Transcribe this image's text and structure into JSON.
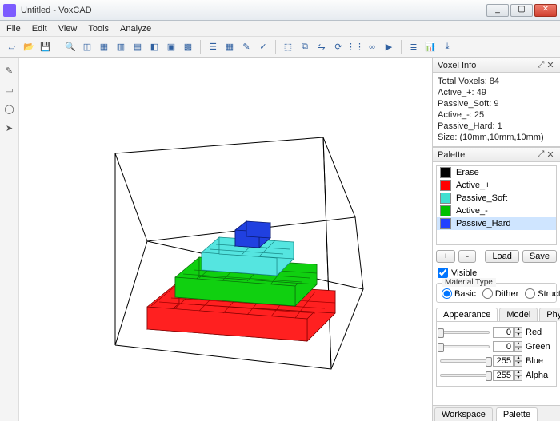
{
  "window": {
    "title": "Untitled - VoxCAD"
  },
  "menu": [
    "File",
    "Edit",
    "View",
    "Tools",
    "Analyze"
  ],
  "toolbar_icons": [
    "new-icon",
    "open-icon",
    "save-icon",
    "",
    "zoom-extents-icon",
    "view-persp-icon",
    "view-top-icon",
    "view-front-icon",
    "view-side-icon",
    "view-iso-icon",
    "wireframe-icon",
    "shaded-icon",
    "",
    "list-icon",
    "grid-icon",
    "paint-icon",
    "check-icon",
    "",
    "select-icon",
    "copy-icon",
    "mirror-icon",
    "rotate-icon",
    "array-icon",
    "link-icon",
    "sim-icon",
    "",
    "layers-icon",
    "stats-icon",
    "export-icon"
  ],
  "left_tools": [
    "pencil-icon",
    "box-icon",
    "ellipse-icon",
    "pointer-icon"
  ],
  "voxel_info": {
    "title": "Voxel Info",
    "lines": [
      "Total Voxels: 84",
      "Active_+: 49",
      "Passive_Soft: 9",
      "Active_-: 25",
      "Passive_Hard: 1",
      "Size: (10mm,10mm,10mm)"
    ]
  },
  "palette": {
    "title": "Palette",
    "materials": [
      {
        "name": "Erase",
        "color": "#000000"
      },
      {
        "name": "Active_+",
        "color": "#ff0000"
      },
      {
        "name": "Passive_Soft",
        "color": "#40e0d0"
      },
      {
        "name": "Active_-",
        "color": "#00c000"
      },
      {
        "name": "Passive_Hard",
        "color": "#2040ff"
      }
    ],
    "selected_index": 4,
    "buttons": {
      "add": "+",
      "remove": "-",
      "load": "Load",
      "save": "Save"
    },
    "visible_label": "Visible",
    "visible_checked": true,
    "material_type": {
      "label": "Material Type",
      "options": [
        "Basic",
        "Dither",
        "Structure"
      ],
      "selected": 0
    },
    "prop_tabs": [
      "Appearance",
      "Model",
      "Physical"
    ],
    "prop_tab_selected": 0,
    "channels": [
      {
        "label": "Red",
        "value": 0,
        "pos": 0
      },
      {
        "label": "Green",
        "value": 0,
        "pos": 0
      },
      {
        "label": "Blue",
        "value": 255,
        "pos": 100
      },
      {
        "label": "Alpha",
        "value": 255,
        "pos": 100
      }
    ]
  },
  "bottom_tabs": {
    "items": [
      "Workspace",
      "Palette"
    ],
    "selected": 1
  }
}
